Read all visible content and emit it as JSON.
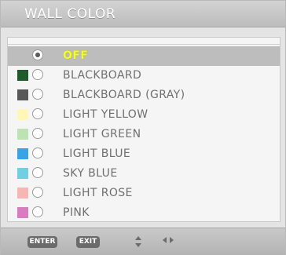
{
  "title": "WALL COLOR",
  "options": [
    {
      "label": "OFF",
      "swatch": null,
      "selected": true
    },
    {
      "label": "BLACKBOARD",
      "swatch": "#1f5a2a",
      "selected": false
    },
    {
      "label": "BLACKBOARD (GRAY)",
      "swatch": "#585858",
      "selected": false
    },
    {
      "label": "LIGHT YELLOW",
      "swatch": "#fff7b7",
      "selected": false
    },
    {
      "label": "LIGHT GREEN",
      "swatch": "#bde3b5",
      "selected": false
    },
    {
      "label": "LIGHT BLUE",
      "swatch": "#3aa3e6",
      "selected": false
    },
    {
      "label": "SKY BLUE",
      "swatch": "#72cfe1",
      "selected": false
    },
    {
      "label": "LIGHT ROSE",
      "swatch": "#f6b6b4",
      "selected": false
    },
    {
      "label": "PINK",
      "swatch": "#d77dbf",
      "selected": false
    }
  ],
  "footer": {
    "enter_label": "ENTER",
    "exit_label": "EXIT",
    "updown_icon": "up-down-arrows-icon",
    "leftright_icon": "left-right-arrows-icon"
  },
  "colors": {
    "selected_label": "#f3ff22",
    "label": "#6f6f6f"
  }
}
